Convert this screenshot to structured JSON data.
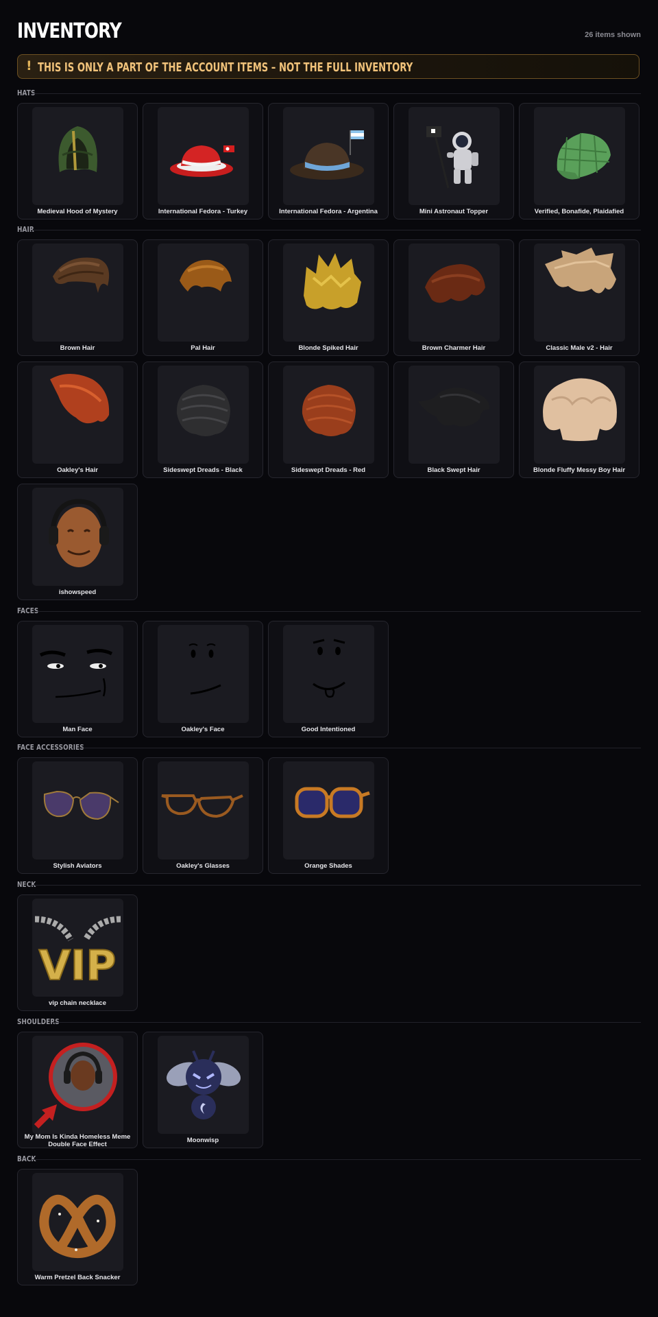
{
  "header": {
    "title": "INVENTORY",
    "count": "26 items shown"
  },
  "banner": {
    "icon": "!",
    "text": "THIS IS ONLY A PART OF THE ACCOUNT ITEMS – NOT THE FULL INVENTORY",
    "icon_name": "exclamation-icon",
    "accent": "#f0c27a"
  },
  "colors": {
    "background": "#08080c",
    "card": "#0f0f14",
    "thumb": "#1b1b21",
    "border": "#26262e"
  },
  "sections": [
    {
      "title": "HATS",
      "items": [
        {
          "name": "Medieval Hood of Mystery"
        },
        {
          "name": "International Fedora - Turkey"
        },
        {
          "name": "International Fedora - Argentina"
        },
        {
          "name": "Mini Astronaut Topper"
        },
        {
          "name": "Verified, Bonafide, Plaidafied"
        }
      ]
    },
    {
      "title": "HAIR",
      "items": [
        {
          "name": "Brown Hair"
        },
        {
          "name": "Pal Hair"
        },
        {
          "name": "Blonde Spiked Hair"
        },
        {
          "name": "Brown Charmer Hair"
        },
        {
          "name": "Classic Male v2 - Hair"
        },
        {
          "name": "Oakley's Hair"
        },
        {
          "name": "Sideswept Dreads - Black"
        },
        {
          "name": "Sideswept Dreads - Red"
        },
        {
          "name": "Black Swept Hair"
        },
        {
          "name": "Blonde Fluffy Messy Boy Hair"
        },
        {
          "name": "ishowspeed"
        }
      ]
    },
    {
      "title": "FACES",
      "items": [
        {
          "name": "Man Face"
        },
        {
          "name": "Oakley's Face"
        },
        {
          "name": "Good Intentioned"
        }
      ]
    },
    {
      "title": "FACE ACCESSORIES",
      "items": [
        {
          "name": "Stylish Aviators"
        },
        {
          "name": "Oakley's Glasses"
        },
        {
          "name": "Orange Shades"
        }
      ]
    },
    {
      "title": "NECK",
      "items": [
        {
          "name": "vip chain necklace"
        }
      ]
    },
    {
      "title": "SHOULDERS",
      "items": [
        {
          "name": "My Mom Is Kinda Homeless Meme Double Face Effect"
        },
        {
          "name": "Moonwisp"
        }
      ]
    },
    {
      "title": "BACK",
      "items": [
        {
          "name": "Warm Pretzel Back Snacker"
        }
      ]
    }
  ]
}
